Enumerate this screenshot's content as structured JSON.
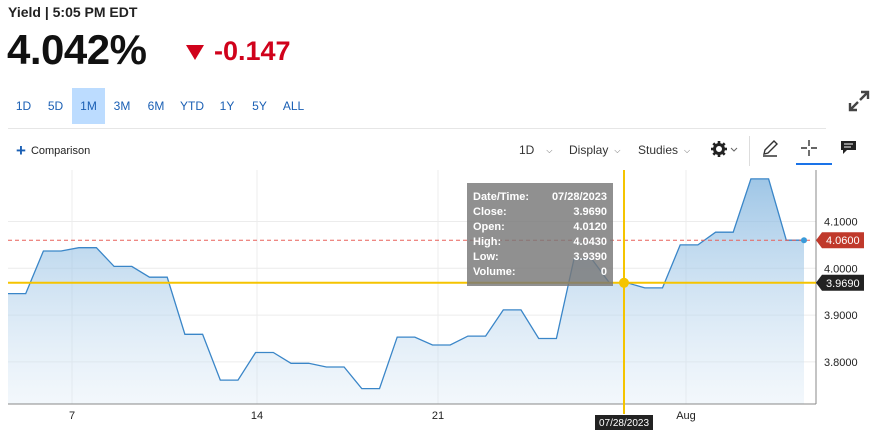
{
  "header": {
    "title": "Yield | 5:05 PM EDT",
    "price": "4.042%",
    "change": "-0.147",
    "change_color": "#d0021b"
  },
  "ranges": [
    {
      "label": "1D",
      "active": false
    },
    {
      "label": "5D",
      "active": false
    },
    {
      "label": "1M",
      "active": true
    },
    {
      "label": "3M",
      "active": false
    },
    {
      "label": "6M",
      "active": false
    },
    {
      "label": "YTD",
      "active": false
    },
    {
      "label": "1Y",
      "active": false
    },
    {
      "label": "5Y",
      "active": false
    },
    {
      "label": "ALL",
      "active": false
    }
  ],
  "toolbar": {
    "comparison": "Comparison",
    "interval": "1D",
    "display": "Display",
    "studies": "Studies"
  },
  "icons": {
    "expand": "expand-icon",
    "settings": "gear-icon",
    "draw": "pencil-icon",
    "crosshair": "crosshair-icon",
    "comment": "comment-icon"
  },
  "tooltip": {
    "rows": [
      {
        "label": "Date/Time:",
        "value": "07/28/2023"
      },
      {
        "label": "Close:",
        "value": "3.9690"
      },
      {
        "label": "Open:",
        "value": "4.0120"
      },
      {
        "label": "High:",
        "value": "4.0430"
      },
      {
        "label": "Low:",
        "value": "3.9390"
      },
      {
        "label": "Volume:",
        "value": "0"
      }
    ]
  },
  "chart_data": {
    "type": "area",
    "y_ticks": [
      "4.1000",
      "4.0000",
      "3.9000",
      "3.8000"
    ],
    "x_ticks": [
      "7",
      "14",
      "21",
      "28",
      "Aug"
    ],
    "ylim": [
      3.71,
      4.21
    ],
    "series": [
      {
        "color": "#3a86c8",
        "x": [
          1,
          2,
          3,
          4,
          5,
          6,
          7,
          8,
          9,
          10,
          11,
          12,
          13,
          14,
          15,
          16,
          17,
          18,
          19,
          20,
          21,
          22,
          23,
          24,
          25,
          26,
          27,
          28,
          29,
          30,
          31,
          32,
          33,
          34,
          35,
          36,
          37,
          38
        ],
        "y": [
          3.946,
          3.946,
          4.037,
          4.037,
          4.044,
          4.044,
          4.004,
          4.004,
          3.981,
          3.981,
          3.859,
          3.859,
          3.761,
          3.761,
          3.82,
          3.82,
          3.797,
          3.797,
          3.789,
          3.789,
          3.743,
          3.743,
          3.853,
          3.853,
          3.836,
          3.836,
          3.855,
          3.855,
          3.911,
          3.911,
          3.85,
          3.85,
          4.02,
          4.02,
          3.969,
          3.969,
          3.958,
          3.958
        ]
      }
    ],
    "series_tail": {
      "x": [
        39,
        40,
        41,
        42,
        43,
        44,
        45,
        46
      ],
      "y": [
        4.05,
        4.05,
        4.077,
        4.077,
        4.191,
        4.191,
        4.06,
        4.06
      ]
    },
    "last_value": "4.0600",
    "last_value_color": "#c0392b",
    "crosshair": {
      "value": "3.9690",
      "date": "07/28/2023",
      "line_color": "#f5c400"
    }
  }
}
